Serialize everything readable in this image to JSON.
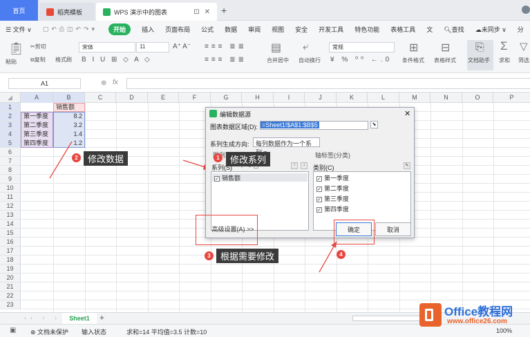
{
  "tabs": {
    "home": "首页",
    "template": "稻壳模板",
    "doc": "WPS 演示中的图表"
  },
  "menu": [
    "文件",
    "开始",
    "插入",
    "页面布局",
    "公式",
    "数据",
    "审阅",
    "视图",
    "安全",
    "开发工具",
    "特色功能",
    "表格工具",
    "文",
    "查找",
    "未同步",
    "分"
  ],
  "ribbon": {
    "paste": "粘贴",
    "cut": "剪切",
    "copy": "复制",
    "format_painter": "格式刷",
    "font_name": "宋体",
    "font_size": "11",
    "merge": "合并居中",
    "wrap": "自动换行",
    "number_format": "常规",
    "cond_format": "条件格式",
    "table_style": "表格样式",
    "doc_helper": "文档助手",
    "sum": "求和",
    "filter": "筛选"
  },
  "formula": {
    "cell_ref": "A1",
    "fx": "fx"
  },
  "columns": [
    "A",
    "B",
    "C",
    "D",
    "E",
    "F",
    "G",
    "H",
    "I",
    "J",
    "K",
    "L",
    "M",
    "N",
    "O",
    "P"
  ],
  "rows": [
    "1",
    "2",
    "3",
    "4",
    "5",
    "6",
    "7",
    "8",
    "9",
    "10",
    "11",
    "12",
    "13",
    "14",
    "15",
    "16",
    "17",
    "18",
    "19",
    "20",
    "21",
    "22",
    "23"
  ],
  "cells": {
    "b1": "销售额",
    "a2": "第一季度",
    "b2": "8.2",
    "a3": "第二季度",
    "b3": "3.2",
    "a4": "第三季度",
    "b4": "1.4",
    "a5": "第四季度",
    "b5": "1.2"
  },
  "dialog": {
    "title": "编辑数据源",
    "range_label": "图表数据区域(D):",
    "range_value": "=Sheet1!$A$1:$B$5",
    "series_dir_label": "系列生成方向:",
    "series_dir_value": "每列数据作为一个系列",
    "legend_label": "图例项(系列)",
    "series_label": "系列(S)",
    "axis_label": "轴标签(分类)",
    "category_label": "类别(C)",
    "series_items": [
      "销售额"
    ],
    "category_items": [
      "第一季度",
      "第二季度",
      "第三季度",
      "第四季度"
    ],
    "advanced_button": "高级设置(A) >>",
    "ok_button": "确定",
    "cancel_button": "取消"
  },
  "annotations": {
    "n1": "1",
    "t1": "修改系列",
    "n2": "2",
    "t2": "修改数据",
    "n3": "3",
    "t3": "根据需要修改",
    "n4": "4"
  },
  "sheet_tab": "Sheet1",
  "status": {
    "protect": "文档未保护",
    "input": "输入状态",
    "stats": "求和=14 平均值=3.5 计数=10",
    "zoom": "100%"
  },
  "watermark": {
    "brand": "Office教程网",
    "url": "www.office26.com"
  },
  "colors": {
    "accent_blue": "#4c7df0",
    "start_green": "#28b25f",
    "annotation_red": "#e8473f",
    "selection": "#dbe3f5"
  }
}
